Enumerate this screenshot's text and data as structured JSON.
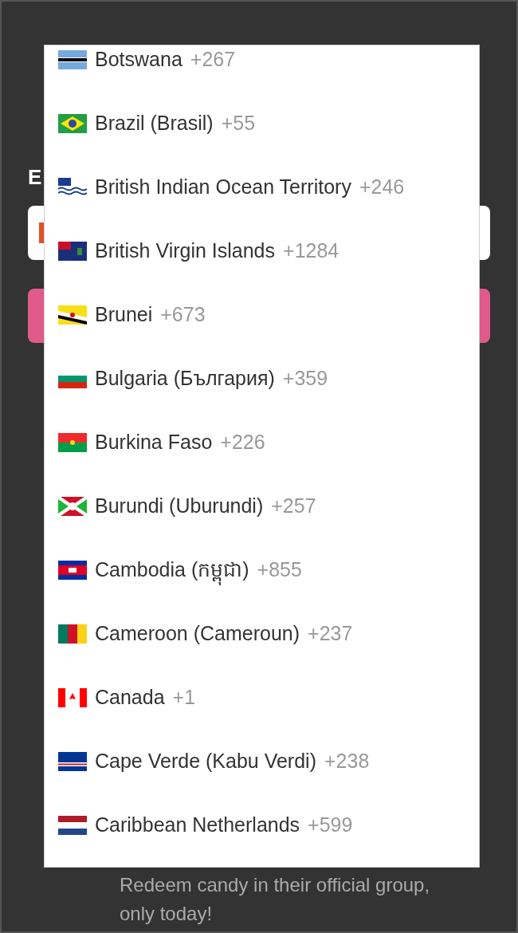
{
  "form": {
    "label": "E"
  },
  "dropdown": {
    "items": [
      {
        "name": "Botswana",
        "code": "+267"
      },
      {
        "name": "Brazil (Brasil)",
        "code": "+55"
      },
      {
        "name": "British Indian Ocean Territory",
        "code": "+246"
      },
      {
        "name": "British Virgin Islands",
        "code": "+1284"
      },
      {
        "name": "Brunei",
        "code": "+673"
      },
      {
        "name": "Bulgaria (България)",
        "code": "+359"
      },
      {
        "name": "Burkina Faso",
        "code": "+226"
      },
      {
        "name": "Burundi (Uburundi)",
        "code": "+257"
      },
      {
        "name": "Cambodia (កម្ពុជា)",
        "code": "+855"
      },
      {
        "name": "Cameroon (Cameroun)",
        "code": "+237"
      },
      {
        "name": "Canada",
        "code": "+1"
      },
      {
        "name": "Cape Verde (Kabu Verdi)",
        "code": "+238"
      },
      {
        "name": "Caribbean Netherlands",
        "code": "+599"
      }
    ]
  },
  "footer_text": "Redeem candy in their official group, only today!"
}
